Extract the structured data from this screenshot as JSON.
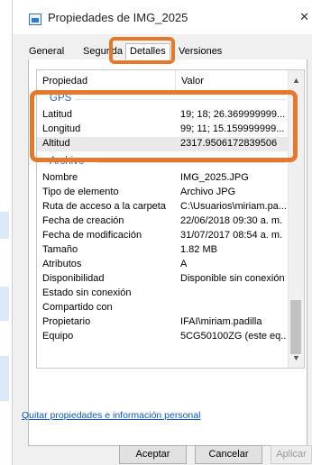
{
  "window": {
    "title": "Propiedades de IMG_2025"
  },
  "tabs": [
    {
      "label": "General"
    },
    {
      "label": "Segurida"
    },
    {
      "label": "Detalles"
    },
    {
      "label": "Versiones anteriores"
    }
  ],
  "list": {
    "headers": {
      "property": "Propiedad",
      "value": "Valor"
    },
    "groups": [
      {
        "name": "GPS",
        "rows": [
          {
            "key": "Latitud",
            "value": "19; 18; 26.369999999..."
          },
          {
            "key": "Longitud",
            "value": "99; 11; 15.159999999..."
          },
          {
            "key": "Altitud",
            "value": "2317.9506172839506"
          }
        ]
      },
      {
        "name": "Archivo",
        "rows": [
          {
            "key": "Nombre",
            "value": "IMG_2025.JPG"
          },
          {
            "key": "Tipo de elemento",
            "value": "Archivo JPG"
          },
          {
            "key": "Ruta de acceso a la carpeta",
            "value": "C:\\Usuarios\\miriam.pa..."
          },
          {
            "key": "Fecha de creación",
            "value": "22/06/2018 09:30 a. m."
          },
          {
            "key": "Fecha de modificación",
            "value": "31/07/2017 08:54 a. m."
          },
          {
            "key": "Tamaño",
            "value": "1.82 MB"
          },
          {
            "key": "Atributos",
            "value": "A"
          },
          {
            "key": "Disponibilidad",
            "value": "Disponible sin conexión"
          },
          {
            "key": "Estado sin conexión",
            "value": ""
          },
          {
            "key": "Compartido con",
            "value": ""
          },
          {
            "key": "Propietario",
            "value": "IFAI\\miriam.padilla"
          },
          {
            "key": "Equipo",
            "value": "5CG50100ZG (este eq..."
          }
        ]
      }
    ]
  },
  "link": {
    "label": "Quitar propiedades e información personal"
  },
  "buttons": {
    "ok": "Aceptar",
    "cancel": "Cancelar",
    "apply": "Aplicar"
  },
  "colors": {
    "highlight": "#e6782b",
    "group_header": "#3c64b4",
    "link": "#0b57c1"
  }
}
